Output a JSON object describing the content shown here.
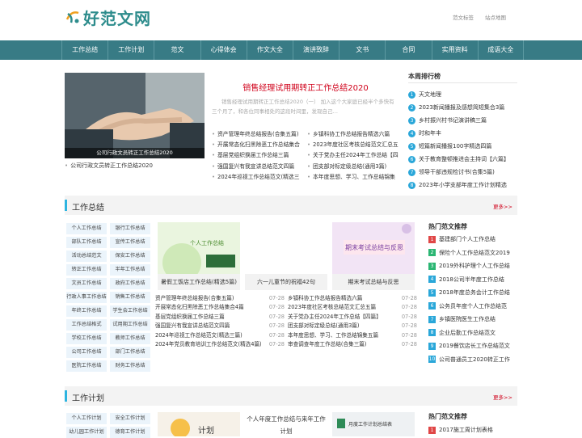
{
  "header": {
    "logo_text": "好范文网",
    "top_links": [
      "范文标签",
      "站点地图"
    ]
  },
  "nav": [
    "工作总结",
    "工作计划",
    "范文",
    "心得体会",
    "作文大全",
    "演讲致辞",
    "文书",
    "合同",
    "实用资料",
    "成语大全"
  ],
  "hero": {
    "image_caption": "公司行政文员转正工作总结2020",
    "below_caption": "公司行政文员转正工作总结2020",
    "headline": "销售经理试用期转正工作总结2020",
    "summary": "销售经理试用期转正工作总结2020（一） 加入这个大家庭已经半个多快有三个月了，和各位同事相处的这段时间里，发现自己…",
    "list": [
      "资产管理年终总结报告(合集五篇)",
      "乡镇科协工作总结报告精选六篇",
      "开展常态化扫黑除恶工作总结集合",
      "2023年度社区考核总结范文汇总五",
      "基层党组织换届工作总结三篇",
      "关于党办主任2024年工作总结【四",
      "强国复兴有我宣讲总结范文四篇",
      "团支部对标定级总结(通用3篇)",
      "2024年巡视工作总结范文(精选三",
      "本年度思想、学习、工作总结锦集"
    ]
  },
  "week_rank": {
    "title": "本周排行榜",
    "items": [
      "天文地理",
      "2023新闻播报及感想简短集合3篇",
      "乡村振兴村书记演讲稿三篇",
      "时和年丰",
      "短篇新闻播报100字精选四篇",
      "关于教育整顿推进会主持词【六篇】",
      "领导干部违规检讨书(合集5篇)",
      "2023年小学支部年度工作计划精选"
    ],
    "colors": [
      "#2aa7d9",
      "#2aa7d9",
      "#2aa7d9",
      "#2aa7d9",
      "#2aa7d9",
      "#2aa7d9",
      "#2aa7d9",
      "#2aa7d9"
    ]
  },
  "section1": {
    "title": "工作总结",
    "more": "更多>>",
    "categories": [
      "个人工作总结",
      "银行工作总结",
      "部队工作总结",
      "宣传工作总结",
      "活动总结范文",
      "保安工作总结",
      "转正工作总结",
      "半年工作总结",
      "文员工作总结",
      "政府工作总结",
      "行政人事工作总结",
      "销售工作总结",
      "年终工作总结",
      "学生会工作总结",
      "工作总结格式",
      "试用期工作总结",
      "学校工作总结",
      "教师工作总结",
      "公司工作总结",
      "部门工作总结",
      "医院工作总结",
      "财务工作总结"
    ],
    "thumbs": [
      {
        "caption": "暑假工饭店工作总结(精选5篇)",
        "img_text": "暑假工饭店工作总结"
      },
      {
        "caption": "六一儿童节的祝福42句",
        "img_text": ""
      },
      {
        "caption": "期末考试总结与反思",
        "img_text": "期末考试总结与反思"
      }
    ],
    "articles": [
      {
        "left": "资产管理年终总结报告(合集五篇)",
        "left_date": "07-28",
        "right": "乡镇科协工作总结报告精选六篇",
        "right_date": "07-28"
      },
      {
        "left": "开展常态化扫黑除恶工作总结集合4篇",
        "left_date": "07-28",
        "right": "2023年度社区考核总结范文汇总五篇",
        "right_date": "07-28"
      },
      {
        "left": "基层党组织换届工作总结三篇",
        "left_date": "07-28",
        "right": "关于党办主任2024年工作总结【四篇】",
        "right_date": "07-28"
      },
      {
        "left": "强国复兴有我宣讲总结范文四篇",
        "left_date": "07-28",
        "right": "团支部对标定级总结(通用3篇)",
        "right_date": "07-28"
      },
      {
        "left": "2024年巡视工作总结范文(精选三篇)",
        "left_date": "07-28",
        "right": "本年度思想、学习、工作总结锦集五篇",
        "right_date": "07-28"
      },
      {
        "left": "2024年党员教育培训工作总结范文(精选4篇)",
        "left_date": "07-28",
        "right": "审查调查年度工作总结(合集三篇)",
        "right_date": "07-28"
      }
    ],
    "hot_title": "热门范文推荐",
    "hot": [
      "基建部门个人工作总结",
      "保险个人工作总结范文2019",
      "2019外科护理个人工作总结",
      "2018公司半年度工作总结",
      "2018年度总务会计工作总结",
      "公务员年度个人工作总结范",
      "乡镇医院医生工作总结",
      "企业后勤工作总结范文",
      "2019餐饮店长工作总结范文",
      "公司普通员工2020转正工作"
    ],
    "hot_colors": [
      "#e04646",
      "#2bb673",
      "#2bb673",
      "#2aa7d9",
      "#2aa7d9",
      "#2aa7d9",
      "#2aa7d9",
      "#2aa7d9",
      "#2aa7d9",
      "#2aa7d9"
    ]
  },
  "section2": {
    "title": "工作计划",
    "more": "更多>>",
    "categories": [
      "个人工作计划",
      "安全工作计划",
      "幼儿园工作计划",
      "德育工作计划"
    ],
    "thumb_text": "个人年度工作总结与来年工作计划",
    "thumb2_text": "月度工作计划总结表",
    "hot_title": "热门范文推荐",
    "hot": [
      "2017施工周计划表格"
    ]
  }
}
